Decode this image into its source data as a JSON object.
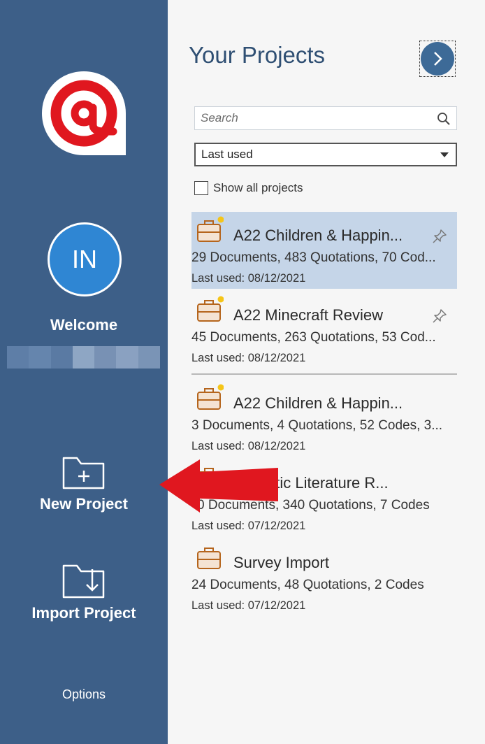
{
  "sidebar": {
    "avatar_initials": "IN",
    "welcome": "Welcome",
    "new_project": "New Project",
    "import_project": "Import Project",
    "options": "Options"
  },
  "main": {
    "title": "Your Projects",
    "search_placeholder": "Search",
    "sort_value": "Last used",
    "show_all_label": "Show all projects",
    "projects": [
      {
        "name": "A22 Children & Happin...",
        "stats": "29 Documents, 483 Quotations, 70 Cod...",
        "date": "Last used: 08/12/2021",
        "pinned": true,
        "selected": true,
        "new_dot": true
      },
      {
        "name": "A22 Minecraft Review",
        "stats": "45 Documents, 263 Quotations, 53 Cod...",
        "date": "Last used: 08/12/2021",
        "pinned": true,
        "selected": false,
        "new_dot": true
      },
      {
        "name": "A22 Children & Happin...",
        "stats": "3 Documents, 4 Quotations, 52 Codes, 3...",
        "date": "Last used: 08/12/2021",
        "pinned": false,
        "selected": false,
        "new_dot": true
      },
      {
        "name": "atic Literature R...",
        "stats": "0 Documents, 340 Quotations, 7 Codes",
        "date": "Last used: 07/12/2021",
        "pinned": false,
        "selected": false,
        "new_dot": false
      },
      {
        "name": "Survey Import",
        "stats": "24 Documents, 48 Quotations, 2 Codes",
        "date": "Last used: 07/12/2021",
        "pinned": false,
        "selected": false,
        "new_dot": false
      }
    ]
  },
  "colors": {
    "sidebar_bg": "#3d5f88",
    "accent_red": "#e0171f",
    "avatar_blue": "#2f86d3",
    "selected_row": "#c5d5e8",
    "briefcase": "#b5651d",
    "new_dot": "#f5c518"
  },
  "icons": {
    "logo": "atlas-ti-logo",
    "next": "chevron-right-icon",
    "search": "search-icon",
    "project": "briefcase-icon",
    "pin": "pin-icon",
    "new_project": "folder-plus-icon",
    "import_project": "folder-import-icon"
  }
}
